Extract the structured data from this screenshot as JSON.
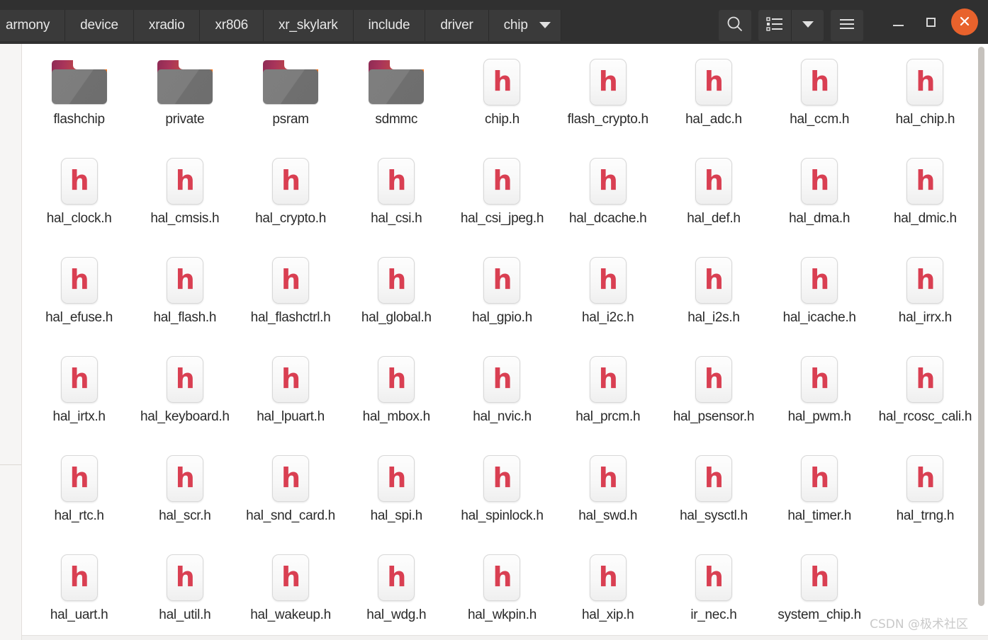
{
  "window": {
    "titlebar_bg": "#303030",
    "close_button_color": "#e8622c",
    "accent_color": "#e8622c"
  },
  "pathbar": {
    "crumbs": [
      {
        "label": "armony",
        "name": "breadcrumb-harmony",
        "has_caret": false
      },
      {
        "label": "device",
        "name": "breadcrumb-device",
        "has_caret": false
      },
      {
        "label": "xradio",
        "name": "breadcrumb-xradio",
        "has_caret": false
      },
      {
        "label": "xr806",
        "name": "breadcrumb-xr806",
        "has_caret": false
      },
      {
        "label": "xr_skylark",
        "name": "breadcrumb-xr-skylark",
        "has_caret": false
      },
      {
        "label": "include",
        "name": "breadcrumb-include",
        "has_caret": false
      },
      {
        "label": "driver",
        "name": "breadcrumb-driver",
        "has_caret": false
      },
      {
        "label": "chip",
        "name": "breadcrumb-chip",
        "has_caret": true
      }
    ]
  },
  "toolbar": {
    "search_icon": "search-icon",
    "view_list_icon": "list-view-icon",
    "view_dropdown_icon": "chevron-down-icon",
    "menu_icon": "hamburger-menu-icon",
    "minimize_icon": "minimize-icon",
    "maximize_icon": "maximize-icon",
    "close_icon": "close-icon"
  },
  "files": [
    {
      "name": "flashchip",
      "type": "folder"
    },
    {
      "name": "private",
      "type": "folder"
    },
    {
      "name": "psram",
      "type": "folder"
    },
    {
      "name": "sdmmc",
      "type": "folder"
    },
    {
      "name": "chip.h",
      "type": "header",
      "glyph": "h"
    },
    {
      "name": "flash_crypto.h",
      "type": "header",
      "glyph": "h"
    },
    {
      "name": "hal_adc.h",
      "type": "header",
      "glyph": "h"
    },
    {
      "name": "hal_ccm.h",
      "type": "header",
      "glyph": "h"
    },
    {
      "name": "hal_chip.h",
      "type": "header",
      "glyph": "h"
    },
    {
      "name": "hal_clock.h",
      "type": "header",
      "glyph": "h"
    },
    {
      "name": "hal_cmsis.h",
      "type": "header",
      "glyph": "h"
    },
    {
      "name": "hal_crypto.h",
      "type": "header",
      "glyph": "h"
    },
    {
      "name": "hal_csi.h",
      "type": "header",
      "glyph": "h"
    },
    {
      "name": "hal_csi_jpeg.h",
      "type": "header",
      "glyph": "h"
    },
    {
      "name": "hal_dcache.h",
      "type": "header",
      "glyph": "h"
    },
    {
      "name": "hal_def.h",
      "type": "header",
      "glyph": "h"
    },
    {
      "name": "hal_dma.h",
      "type": "header",
      "glyph": "h"
    },
    {
      "name": "hal_dmic.h",
      "type": "header",
      "glyph": "h"
    },
    {
      "name": "hal_efuse.h",
      "type": "header",
      "glyph": "h"
    },
    {
      "name": "hal_flash.h",
      "type": "header",
      "glyph": "h"
    },
    {
      "name": "hal_flashctrl.h",
      "type": "header",
      "glyph": "h"
    },
    {
      "name": "hal_global.h",
      "type": "header",
      "glyph": "h"
    },
    {
      "name": "hal_gpio.h",
      "type": "header",
      "glyph": "h"
    },
    {
      "name": "hal_i2c.h",
      "type": "header",
      "glyph": "h"
    },
    {
      "name": "hal_i2s.h",
      "type": "header",
      "glyph": "h"
    },
    {
      "name": "hal_icache.h",
      "type": "header",
      "glyph": "h"
    },
    {
      "name": "hal_irrx.h",
      "type": "header",
      "glyph": "h"
    },
    {
      "name": "hal_irtx.h",
      "type": "header",
      "glyph": "h"
    },
    {
      "name": "hal_keyboard.h",
      "type": "header",
      "glyph": "h"
    },
    {
      "name": "hal_lpuart.h",
      "type": "header",
      "glyph": "h"
    },
    {
      "name": "hal_mbox.h",
      "type": "header",
      "glyph": "h"
    },
    {
      "name": "hal_nvic.h",
      "type": "header",
      "glyph": "h"
    },
    {
      "name": "hal_prcm.h",
      "type": "header",
      "glyph": "h"
    },
    {
      "name": "hal_psensor.h",
      "type": "header",
      "glyph": "h"
    },
    {
      "name": "hal_pwm.h",
      "type": "header",
      "glyph": "h"
    },
    {
      "name": "hal_rcosc_cali.h",
      "type": "header",
      "glyph": "h"
    },
    {
      "name": "hal_rtc.h",
      "type": "header",
      "glyph": "h"
    },
    {
      "name": "hal_scr.h",
      "type": "header",
      "glyph": "h"
    },
    {
      "name": "hal_snd_card.h",
      "type": "header",
      "glyph": "h"
    },
    {
      "name": "hal_spi.h",
      "type": "header",
      "glyph": "h"
    },
    {
      "name": "hal_spinlock.h",
      "type": "header",
      "glyph": "h"
    },
    {
      "name": "hal_swd.h",
      "type": "header",
      "glyph": "h"
    },
    {
      "name": "hal_sysctl.h",
      "type": "header",
      "glyph": "h"
    },
    {
      "name": "hal_timer.h",
      "type": "header",
      "glyph": "h"
    },
    {
      "name": "hal_trng.h",
      "type": "header",
      "glyph": "h"
    },
    {
      "name": "hal_uart.h",
      "type": "header",
      "glyph": "h"
    },
    {
      "name": "hal_util.h",
      "type": "header",
      "glyph": "h"
    },
    {
      "name": "hal_wakeup.h",
      "type": "header",
      "glyph": "h"
    },
    {
      "name": "hal_wdg.h",
      "type": "header",
      "glyph": "h"
    },
    {
      "name": "hal_wkpin.h",
      "type": "header",
      "glyph": "h"
    },
    {
      "name": "hal_xip.h",
      "type": "header",
      "glyph": "h"
    },
    {
      "name": "ir_nec.h",
      "type": "header",
      "glyph": "h"
    },
    {
      "name": "system_chip.h",
      "type": "header",
      "glyph": "h"
    }
  ],
  "watermark": {
    "text": "CSDN @极术社区"
  }
}
